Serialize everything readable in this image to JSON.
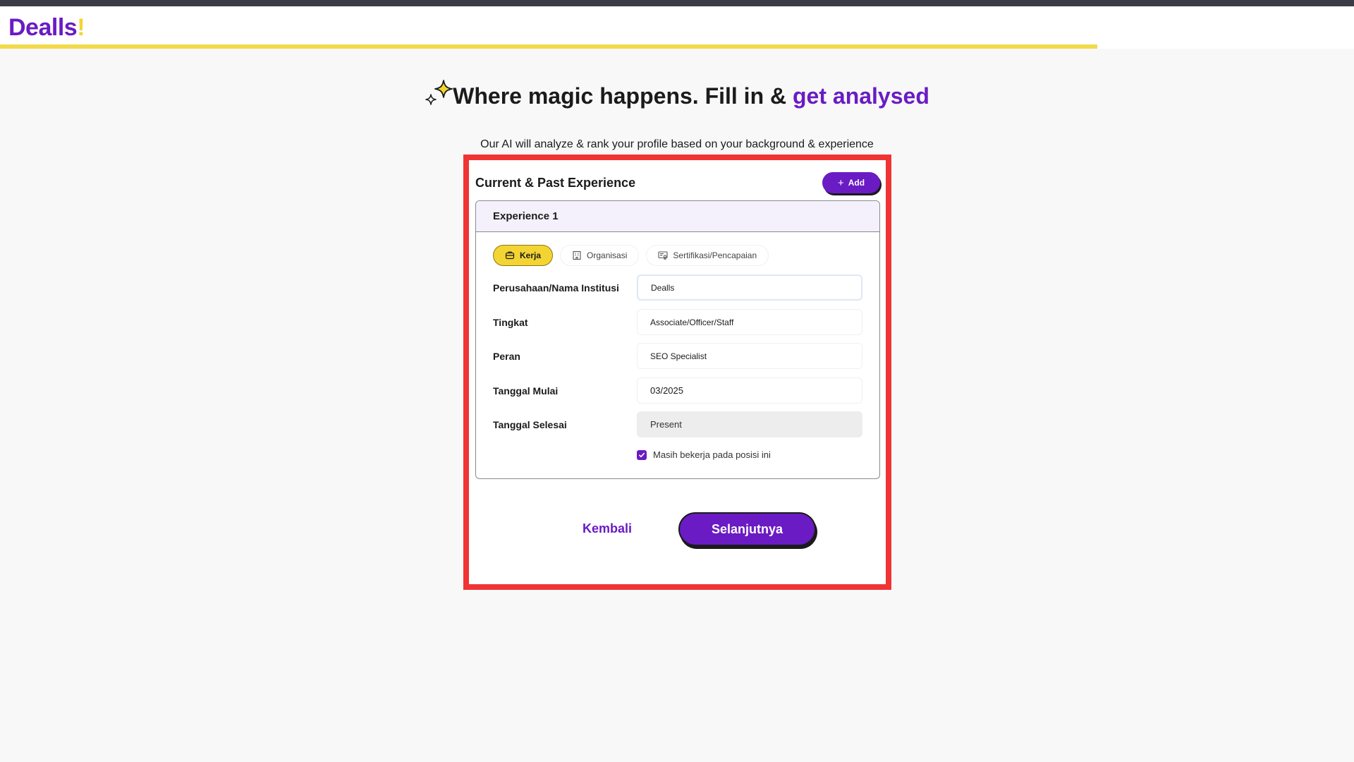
{
  "header": {
    "logo_text": "Dealls",
    "logo_mark": "!",
    "progress_fraction": 0.81
  },
  "hero": {
    "title_main": "Where magic happens. Fill in & ",
    "title_accent": "get analysed",
    "subtitle": "Our AI will analyze & rank your profile based on your background & experience",
    "sparkle_icon": "sparkle-icon"
  },
  "section": {
    "title": "Current & Past Experience",
    "add_label": "Add"
  },
  "experience": {
    "title": "Experience 1",
    "tabs": [
      {
        "label": "Kerja",
        "icon": "briefcase-icon",
        "active": true
      },
      {
        "label": "Organisasi",
        "icon": "building-icon",
        "active": false
      },
      {
        "label": "Sertifikasi/Pencapaian",
        "icon": "certificate-icon",
        "active": false
      }
    ],
    "fields": [
      {
        "label": "Perusahaan/Nama Institusi",
        "value": "Dealls"
      },
      {
        "label": "Tingkat",
        "value": "Associate/Officer/Staff"
      },
      {
        "label": "Peran",
        "value": "SEO Specialist"
      },
      {
        "label": "Tanggal Mulai",
        "value": "03/2025"
      },
      {
        "label": "Tanggal Selesai",
        "value": "Present"
      }
    ],
    "still_working_label": "Masih bekerja pada posisi ini",
    "still_working_checked": true
  },
  "actions": {
    "back_label": "Kembali",
    "next_label": "Selanjutnya"
  },
  "colors": {
    "brand_purple": "#6a1bc4",
    "brand_yellow": "#f3d433",
    "highlight_red": "#f03434"
  }
}
